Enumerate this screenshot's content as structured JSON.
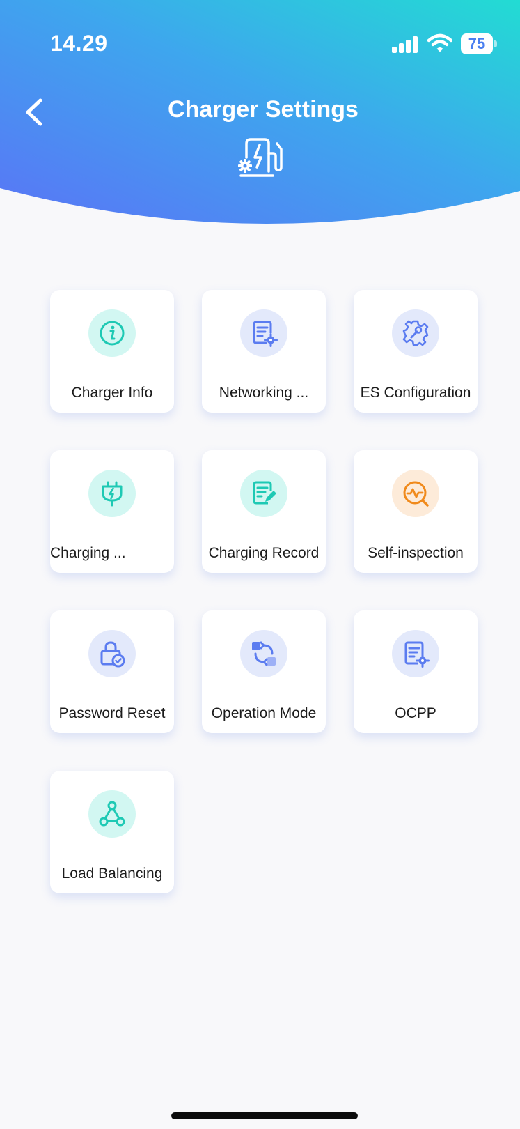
{
  "status_bar": {
    "time": "14.29",
    "battery_level": "75",
    "icons": [
      "signal-icon",
      "wifi-icon",
      "battery-icon"
    ]
  },
  "header": {
    "title": "Charger Settings",
    "back_icon": "chevron-left-icon",
    "hero_icon": "charger-gear-icon",
    "gradient_start": "#4d7bf5",
    "gradient_end": "#23d8d6"
  },
  "menu": {
    "items": [
      {
        "label": "Charger Info",
        "icon": "info-icon",
        "tint": "#d2f7f2",
        "icon_color": "#1ec9b4"
      },
      {
        "label": "Networking ...",
        "icon": "document-gear-icon",
        "tint": "#e3e9fb",
        "icon_color": "#5b7cf0"
      },
      {
        "label": "ES Configuration",
        "icon": "gear-wrench-icon",
        "tint": "#e3e9fb",
        "icon_color": "#5b7cf0"
      },
      {
        "label": "Charging ...",
        "icon": "plug-bolt-icon",
        "tint": "#d2f7f2",
        "icon_color": "#1ec9b4"
      },
      {
        "label": "Charging Record",
        "icon": "document-edit-icon",
        "tint": "#d2f7f2",
        "icon_color": "#1ec9b4"
      },
      {
        "label": "Self-inspection",
        "icon": "pulse-search-icon",
        "tint": "#fdebd9",
        "icon_color": "#f08a1c"
      },
      {
        "label": "Password Reset",
        "icon": "lock-check-icon",
        "tint": "#e3e9fb",
        "icon_color": "#5b7cf0"
      },
      {
        "label": "Operation Mode",
        "icon": "mode-switch-icon",
        "tint": "#e3e9fb",
        "icon_color": "#5b7cf0"
      },
      {
        "label": "OCPP",
        "icon": "document-gear-icon",
        "tint": "#e3e9fb",
        "icon_color": "#5b7cf0"
      },
      {
        "label": "Load Balancing",
        "icon": "triangle-nodes-icon",
        "tint": "#d2f7f2",
        "icon_color": "#1ec9b4"
      }
    ]
  }
}
